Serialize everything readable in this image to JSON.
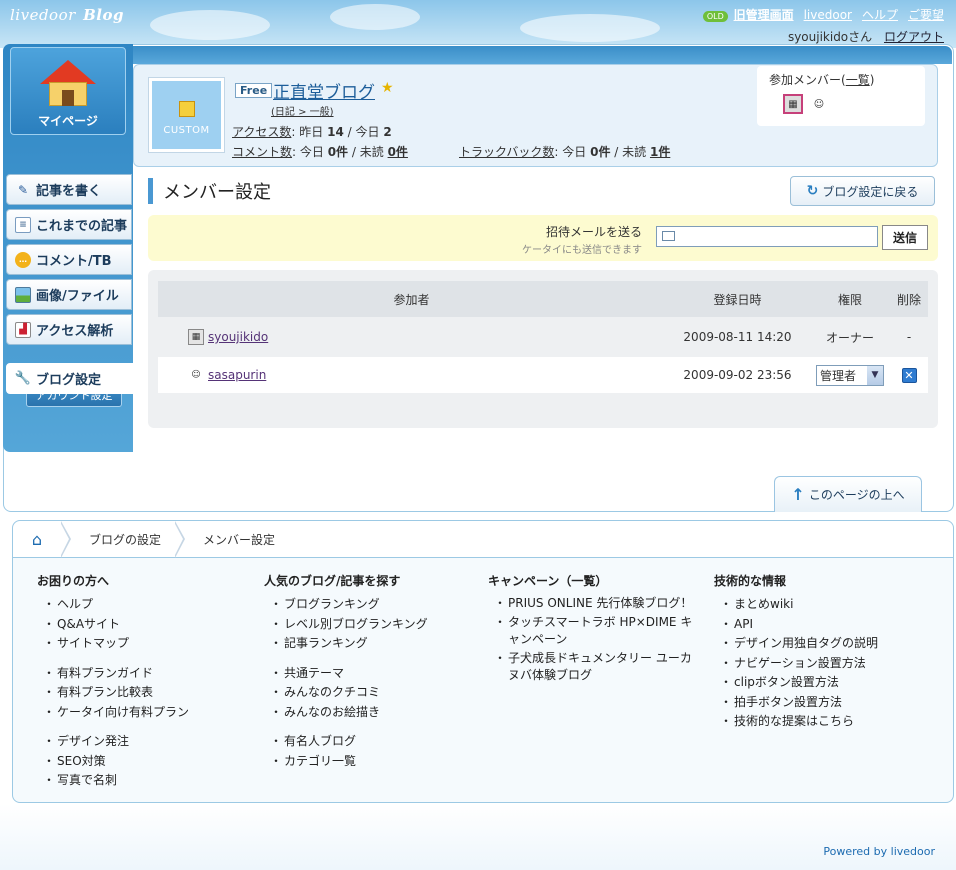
{
  "header": {
    "logo_text": "livedoor",
    "logo_blog": "Blog",
    "old_badge": "OLD",
    "old_link": "旧管理画面",
    "links": [
      "livedoor",
      "ヘルプ",
      "ご要望"
    ],
    "user_name": "syoujikidoさん",
    "logout": "ログアウト"
  },
  "sidebar": {
    "mypage_label": "マイページ",
    "items": [
      {
        "label": "記事を書く",
        "icon": "pencil-icon"
      },
      {
        "label": "これまでの記事",
        "icon": "document-icon"
      },
      {
        "label": "コメント/TB",
        "icon": "speech-bubble-icon"
      },
      {
        "label": "画像/ファイル",
        "icon": "image-icon"
      },
      {
        "label": "アクセス解析",
        "icon": "bar-chart-icon"
      },
      {
        "label": "ブログ設定",
        "icon": "wrench-icon"
      }
    ],
    "account_button": "アカウント設定"
  },
  "blog": {
    "custom_label": "CUSTOM",
    "plan_badge": "Free",
    "title": "正直堂ブログ",
    "category": "(日記 > 一般)",
    "access_label": "アクセス数",
    "access_text": ": 昨日",
    "yesterday": "14",
    "today_text": "/ 今日",
    "today": "2",
    "comment_label": "コメント数",
    "comment_text": ": 今日",
    "comment_today": "0件",
    "unread_text": "/ 未読",
    "comment_unread": "0件",
    "tb_label": "トラックバック数",
    "tb_text": ": 今日",
    "tb_today": "0件",
    "tb_unread_text": "/ 未読",
    "tb_unread": "1件",
    "members_label": "参加メンバー(",
    "members_link": "一覧",
    "members_close": ")"
  },
  "section": {
    "title": "メンバー設定",
    "back_button": "ブログ設定に戻る"
  },
  "invite": {
    "label": "招待メールを送る",
    "sublabel": "ケータイにも送信できます",
    "input_value": "",
    "send_button": "送信"
  },
  "table": {
    "headers": [
      "参加者",
      "登録日時",
      "権限",
      "削除"
    ],
    "rows": [
      {
        "user": "syoujikido",
        "date": "2009-08-11 14:20",
        "role": "オーナー",
        "delete": "-"
      },
      {
        "user": "sasapurin",
        "date": "2009-09-02 23:56",
        "role": "管理者",
        "delete": "✕"
      }
    ]
  },
  "to_top": "このページの上へ",
  "breadcrumb": [
    "ブログの設定",
    "メンバー設定"
  ],
  "footer": {
    "col1": {
      "title": "お困りの方へ",
      "groups": [
        [
          "ヘルプ",
          "Q&Aサイト",
          "サイトマップ"
        ],
        [
          "有料プランガイド",
          "有料プラン比較表",
          "ケータイ向け有料プラン"
        ],
        [
          "デザイン発注",
          "SEO対策",
          "写真で名刺"
        ]
      ]
    },
    "col2": {
      "title": "人気のブログ/記事を探す",
      "groups": [
        [
          "ブログランキング",
          "レベル別ブログランキング",
          "記事ランキング"
        ],
        [
          "共通テーマ",
          "みんなのクチコミ",
          "みんなのお絵描き"
        ],
        [
          "有名人ブログ",
          "カテゴリ一覧"
        ]
      ]
    },
    "col3": {
      "title": "キャンペーン（一覧）",
      "items": [
        "PRIUS ONLINE 先行体験ブログ！",
        "タッチスマートラボ HP×DIME キャンペーン",
        "子犬成長ドキュメンタリー ユーカヌバ体験ブログ"
      ]
    },
    "col4": {
      "title": "技術的な情報",
      "items": [
        "まとめwiki",
        "API",
        "デザイン用独自タグの説明",
        "ナビゲーション設置方法",
        "clipボタン設置方法",
        "拍手ボタン設置方法",
        "技術的な提案はこちら"
      ]
    }
  },
  "powered_by": "Powered by livedoor",
  "colors": {
    "accent": "#2f86c4",
    "invite_bg": "#fdfbd0"
  }
}
